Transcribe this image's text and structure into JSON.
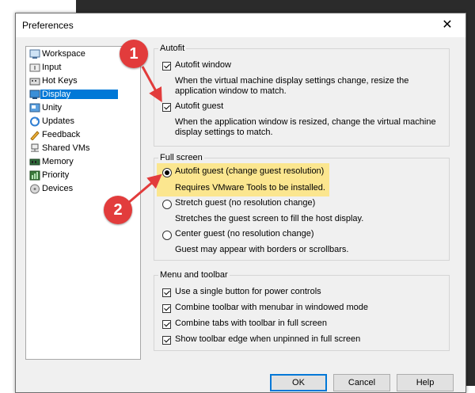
{
  "window": {
    "title": "Preferences",
    "close_glyph": "✕"
  },
  "sidebar": {
    "items": [
      {
        "label": "Workspace",
        "icon": "workspace-icon"
      },
      {
        "label": "Input",
        "icon": "input-icon"
      },
      {
        "label": "Hot Keys",
        "icon": "hotkeys-icon"
      },
      {
        "label": "Display",
        "icon": "display-icon",
        "selected": true
      },
      {
        "label": "Unity",
        "icon": "unity-icon"
      },
      {
        "label": "Updates",
        "icon": "updates-icon"
      },
      {
        "label": "Feedback",
        "icon": "feedback-icon"
      },
      {
        "label": "Shared VMs",
        "icon": "shared-vms-icon"
      },
      {
        "label": "Memory",
        "icon": "memory-icon"
      },
      {
        "label": "Priority",
        "icon": "priority-icon"
      },
      {
        "label": "Devices",
        "icon": "devices-icon"
      }
    ]
  },
  "autofit": {
    "title": "Autofit",
    "window_label": "Autofit window",
    "window_desc": "When the virtual machine display settings change, resize the application window to match.",
    "guest_label": "Autofit guest",
    "guest_desc": "When the application window is resized, change the virtual machine display settings to match."
  },
  "fullscreen": {
    "title": "Full screen",
    "opt1_label": "Autofit guest (change guest resolution)",
    "opt1_desc": "Requires VMware Tools to be installed.",
    "opt2_label": "Stretch guest (no resolution change)",
    "opt2_desc": "Stretches the guest screen to fill the host display.",
    "opt3_label": "Center guest (no resolution change)",
    "opt3_desc": "Guest may appear with borders or scrollbars."
  },
  "menu_toolbar": {
    "title": "Menu and toolbar",
    "opt1": "Use a single button for power controls",
    "opt2": "Combine toolbar with menubar in windowed mode",
    "opt3": "Combine tabs with toolbar in full screen",
    "opt4": "Show toolbar edge when unpinned in full screen"
  },
  "buttons": {
    "ok": "OK",
    "cancel": "Cancel",
    "help": "Help"
  },
  "annotations": {
    "badge1": "1",
    "badge2": "2"
  },
  "colors": {
    "accent": "#0078d7",
    "highlight": "#fbe68f",
    "badge": "#e23c3c"
  }
}
